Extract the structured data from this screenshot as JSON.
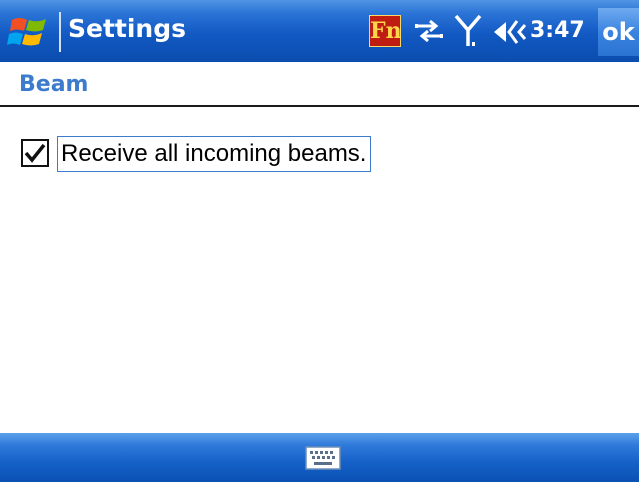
{
  "titlebar": {
    "title": "Settings",
    "start_icon": "windows-flag-icon",
    "fn_label": "Fn",
    "connectivity_icon": "connectivity-arrows-icon",
    "signal_icon": "signal-antenna-icon",
    "volume_icon": "volume-speaker-icon",
    "time": "3:47",
    "ok_label": "ok"
  },
  "page": {
    "title": "Beam"
  },
  "options": {
    "receive_beams": {
      "label": "Receive all incoming beams.",
      "checked": true
    }
  },
  "menubar": {
    "keyboard_icon": "keyboard-icon"
  },
  "colors": {
    "titlebar_blue": "#1259c3",
    "header_text_blue": "#3d7ccd",
    "focus_border": "#3d7ccd"
  }
}
